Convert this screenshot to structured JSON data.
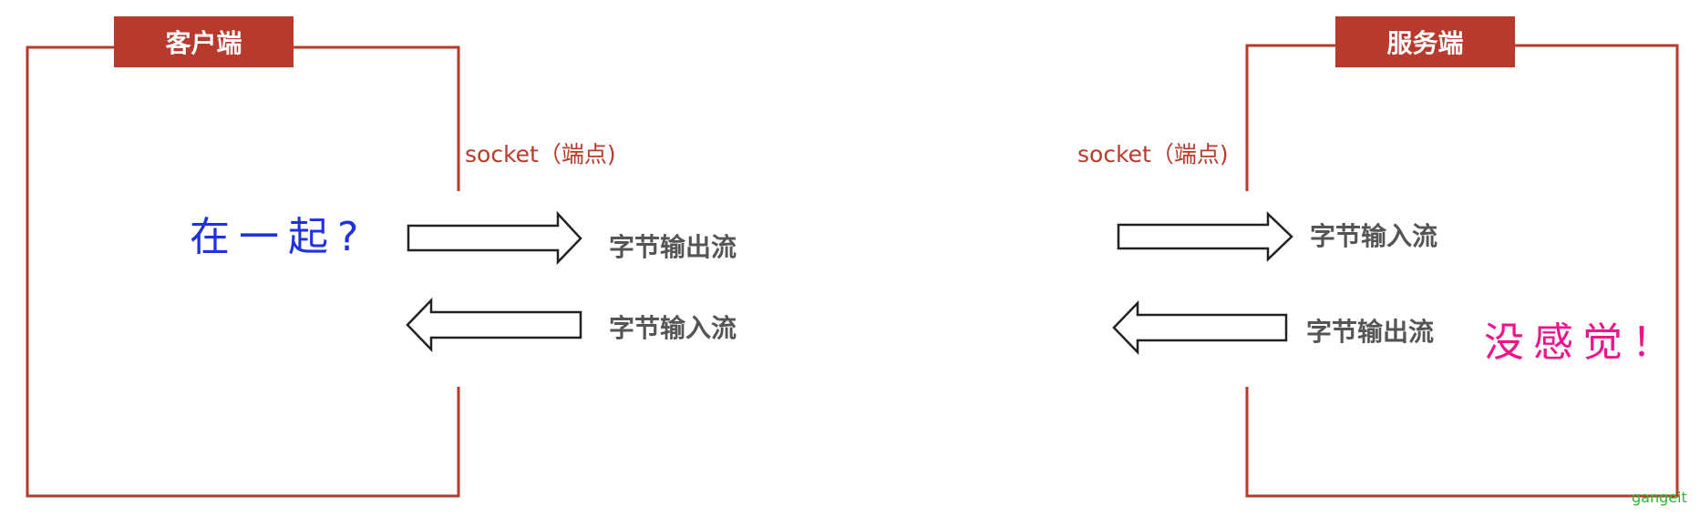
{
  "client": {
    "title": "客户端",
    "socket_label": "socket（端点)"
  },
  "server": {
    "title": "服务端",
    "socket_label": "socket（端点)"
  },
  "client_streams": {
    "output": "字节输出流",
    "input": "字节输入流"
  },
  "server_streams": {
    "input": "字节输入流",
    "output": "字节输出流"
  },
  "question_text": "在一起?",
  "answer_text": "没感觉！",
  "watermark": "gangeit",
  "colors": {
    "frame": "#b83a2c",
    "question": "#1f32e0",
    "answer": "#f0148c",
    "stream_text": "#555555",
    "watermark": "#2eb82e"
  }
}
